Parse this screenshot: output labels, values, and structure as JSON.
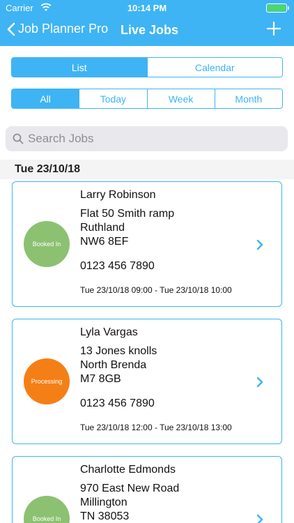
{
  "status_bar": {
    "carrier": "Carrier",
    "time": "10:14 PM"
  },
  "navbar": {
    "back_label": "Job Planner Pro",
    "title": "Live Jobs"
  },
  "view_toggle": [
    "List",
    "Calendar"
  ],
  "filters": [
    "All",
    "Today",
    "Week",
    "Month"
  ],
  "search": {
    "placeholder": "Search Jobs"
  },
  "section_header": "Tue 23/10/18",
  "colors": {
    "accent": "#3eb4f4",
    "booked_in": "#8cc172",
    "processing": "#f57f17"
  },
  "jobs": [
    {
      "status": "Booked In",
      "name": "Larry Robinson",
      "address": [
        "Flat 50 Smith ramp",
        "Ruthland",
        "NW6 8EF"
      ],
      "phone": "0123 456 7890",
      "times": "Tue 23/10/18 09:00 - Tue 23/10/18 10:00"
    },
    {
      "status": "Processing",
      "name": "Lyla Vargas",
      "address": [
        "13 Jones knolls",
        "North Brenda",
        "M7 8GB"
      ],
      "phone": "0123 456 7890",
      "times": "Tue 23/10/18 12:00 - Tue 23/10/18 13:00"
    },
    {
      "status": "Booked In",
      "name": "Charlotte Edmonds",
      "address": [
        "970 East New Road",
        "Millington",
        "TN 38053"
      ],
      "phone": "",
      "times": ""
    }
  ]
}
